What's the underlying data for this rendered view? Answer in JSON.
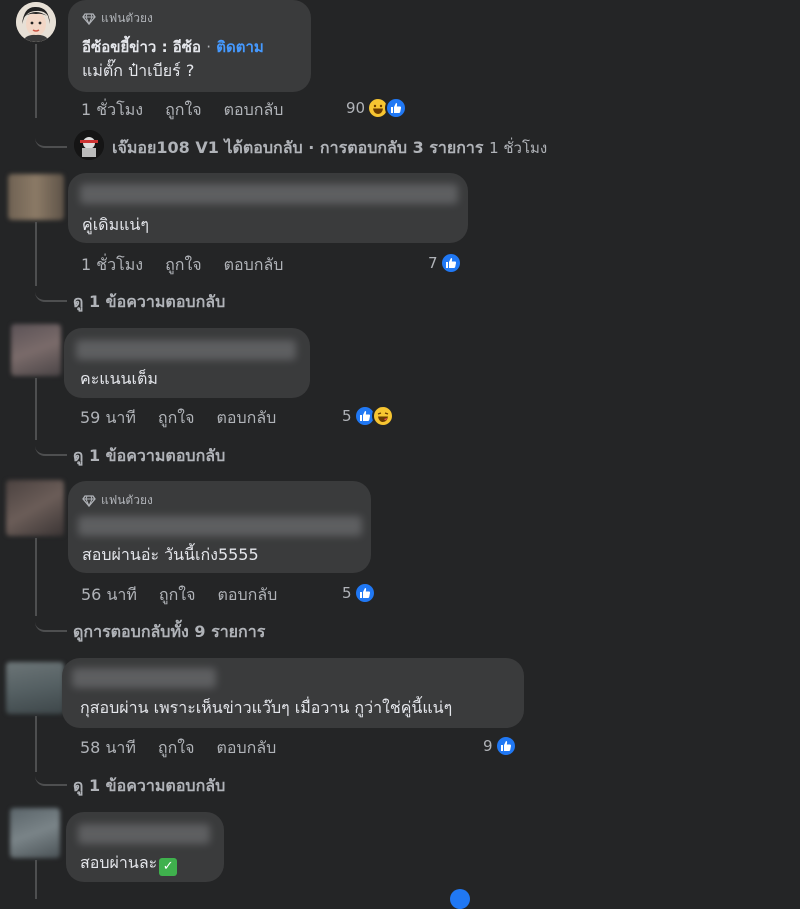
{
  "comments": [
    {
      "badge": "แฟนตัวยง",
      "name": "อีซ้อขยี้ข่าว : อีซ้อ",
      "separator": "·",
      "follow": "ติดตาม",
      "text": "แม่ตั๊ก ป๋าเบียร์ ?",
      "time": "1 ชั่วโมง",
      "like": "ถูกใจ",
      "reply": "ตอบกลับ",
      "reactions": "90",
      "reply_summary": {
        "author": "เจ๊มอย108 V1",
        "action": "ได้ตอบกลับ",
        "separator": "·",
        "count": "การตอบกลับ 3 รายการ",
        "time": "1 ชั่วโมง"
      }
    },
    {
      "text": "คู่เดิมแน่ๆ",
      "time": "1 ชั่วโมง",
      "like": "ถูกใจ",
      "reply": "ตอบกลับ",
      "reactions": "7",
      "more": "ดู 1 ข้อความตอบกลับ"
    },
    {
      "text": "คะแนนเต็ม",
      "time": "59 นาที",
      "like": "ถูกใจ",
      "reply": "ตอบกลับ",
      "reactions": "5",
      "more": "ดู 1 ข้อความตอบกลับ"
    },
    {
      "badge": "แฟนตัวยง",
      "text": "สอบผ่านอ่ะ วันนี้เก่ง5555",
      "time": "56 นาที",
      "like": "ถูกใจ",
      "reply": "ตอบกลับ",
      "reactions": "5",
      "more": "ดูการตอบกลับทั้ง 9 รายการ"
    },
    {
      "text": "กุสอบผ่าน เพราะเห็นข่าวแว๊บๆ เมื่อวาน กูว่าใช่คู่นี้แน่ๆ",
      "time": "58 นาที",
      "like": "ถูกใจ",
      "reply": "ตอบกลับ",
      "reactions": "9",
      "more": "ดู 1 ข้อความตอบกลับ"
    },
    {
      "text": "สอบผ่านละ"
    }
  ],
  "icons": {
    "badge": "diamond-icon",
    "like": "like-icon",
    "haha": "haha-icon",
    "checkmark": "white-check-mark-icon"
  },
  "colors": {
    "background": "#242526",
    "bubble": "#3a3b3c",
    "link": "#4599ff",
    "like_blue": "#2078f4"
  }
}
